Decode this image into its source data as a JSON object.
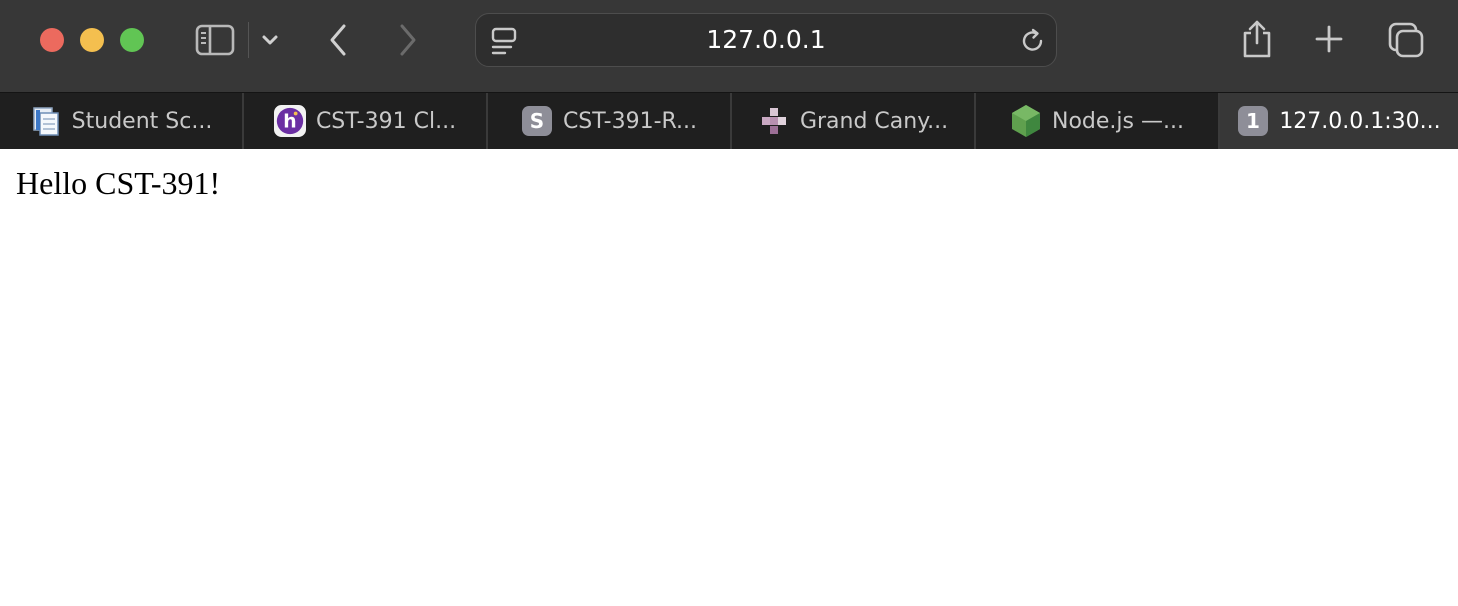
{
  "window": {
    "controls": [
      "close",
      "minimize",
      "zoom"
    ],
    "colors": {
      "close": "#ec6a5e",
      "minimize": "#f4bf4f",
      "zoom": "#61c554",
      "toolbar": "#373737",
      "tabbar": "#1f1f1f"
    }
  },
  "toolbar": {
    "icons": [
      "sidebar-icon",
      "chevron-down-icon",
      "back-arrow-icon",
      "forward-arrow-icon",
      "reader-icon",
      "reload-icon",
      "share-icon",
      "plus-icon",
      "tab-overview-icon"
    ],
    "address": "127.0.0.1"
  },
  "tabs": [
    {
      "label": "Student Sc...",
      "favicon": "document-icon"
    },
    {
      "label": "CST-391 Cl...",
      "favicon": "h-logo-icon"
    },
    {
      "label": "CST-391-R...",
      "favicon": "s-badge-icon",
      "badge": "S"
    },
    {
      "label": "Grand Cany...",
      "favicon": "blocks-icon"
    },
    {
      "label": "Node.js —...",
      "favicon": "nodejs-hexagon-icon"
    },
    {
      "label": "127.0.0.1:30...",
      "favicon": "number-badge-icon",
      "badge": "1",
      "active": true
    }
  ],
  "page": {
    "text": "Hello CST-391!"
  }
}
